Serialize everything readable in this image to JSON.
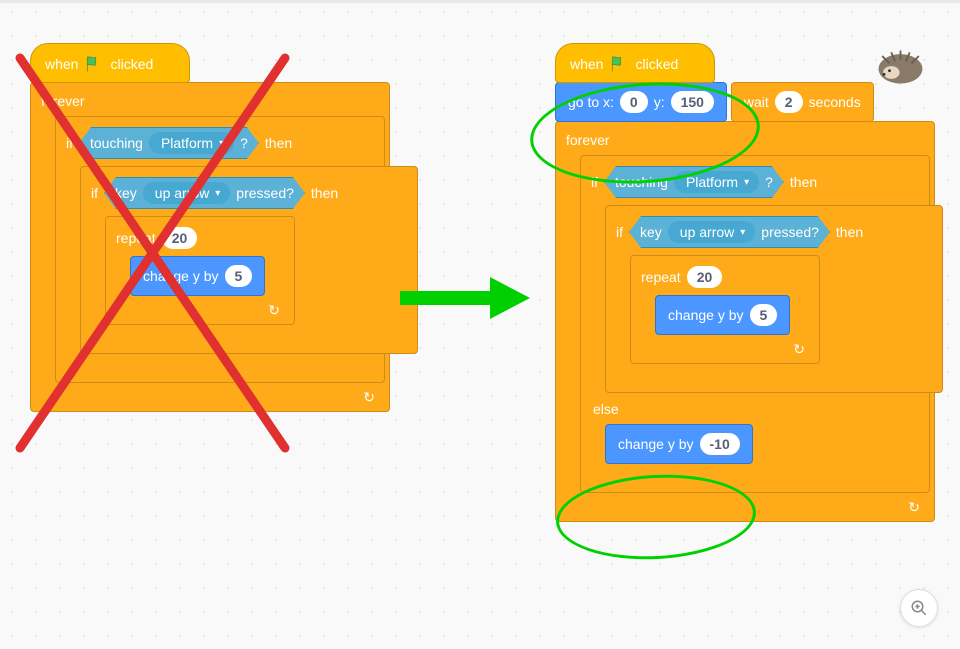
{
  "left": {
    "hat": "when",
    "hat2": "clicked",
    "forever": "forever",
    "if": "if",
    "then": "then",
    "touching": "touching",
    "platform": "Platform",
    "q": "?",
    "key": "key",
    "uparrow": "up arrow",
    "pressed": "pressed?",
    "repeat": "repeat",
    "repeat_n": "20",
    "changey": "change y by",
    "changey_v": "5"
  },
  "right": {
    "hat": "when",
    "hat2": "clicked",
    "gotox": "go to x:",
    "gotox_v": "0",
    "gotoy": "y:",
    "gotoy_v": "150",
    "wait": "wait",
    "wait_v": "2",
    "seconds": "seconds",
    "forever": "forever",
    "if": "if",
    "then": "then",
    "touching": "touching",
    "platform": "Platform",
    "q": "?",
    "key": "key",
    "uparrow": "up arrow",
    "pressed": "pressed?",
    "repeat": "repeat",
    "repeat_n": "20",
    "changey": "change y by",
    "changey_v": "5",
    "else": "else",
    "changey2": "change y by",
    "changey2_v": "-10"
  },
  "colors": {
    "events": "#ffbf00",
    "control": "#ffab19",
    "motion": "#4c97ff",
    "sensing": "#5cb1d6"
  }
}
